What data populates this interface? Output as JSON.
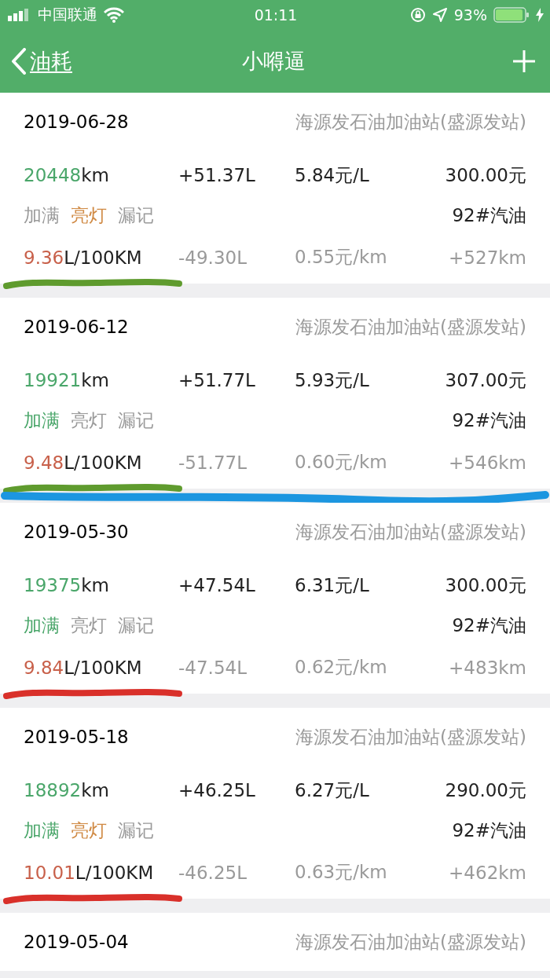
{
  "status_bar": {
    "carrier": "中国联通",
    "time": "01:11",
    "battery": "93%"
  },
  "nav_bar": {
    "back_label": "油耗",
    "title": "小嘚逼"
  },
  "records": [
    {
      "date": "2019-06-28",
      "station": "海源发石油加油站(盛源发站)",
      "odometer": "20448",
      "odometer_unit": "km",
      "volume": "+51.37L",
      "price": "5.84元/L",
      "amount": "300.00元",
      "tags": [
        {
          "kind": "full",
          "label": "加满",
          "on": false
        },
        {
          "kind": "light",
          "label": "亮灯",
          "on": true
        },
        {
          "kind": "missed",
          "label": "漏记",
          "on": false
        }
      ],
      "fuel": "92#汽油",
      "consumption": "9.36",
      "consumption_unit": "L/100KM",
      "used": "-49.30L",
      "cost_per_km": "0.55元/km",
      "distance": "+527km",
      "marks": [
        {
          "kind": "underline",
          "color": "#5f9b2e"
        }
      ]
    },
    {
      "date": "2019-06-12",
      "station": "海源发石油加油站(盛源发站)",
      "odometer": "19921",
      "odometer_unit": "km",
      "volume": "+51.77L",
      "price": "5.93元/L",
      "amount": "307.00元",
      "tags": [
        {
          "kind": "full",
          "label": "加满",
          "on": true
        },
        {
          "kind": "light",
          "label": "亮灯",
          "on": false
        },
        {
          "kind": "missed",
          "label": "漏记",
          "on": false
        }
      ],
      "fuel": "92#汽油",
      "consumption": "9.48",
      "consumption_unit": "L/100KM",
      "used": "-51.77L",
      "cost_per_km": "0.60元/km",
      "distance": "+546km",
      "marks": [
        {
          "kind": "underline",
          "color": "#5f9b2e"
        },
        {
          "kind": "streak",
          "color": "#1c96e0"
        }
      ]
    },
    {
      "date": "2019-05-30",
      "station": "海源发石油加油站(盛源发站)",
      "odometer": "19375",
      "odometer_unit": "km",
      "volume": "+47.54L",
      "price": "6.31元/L",
      "amount": "300.00元",
      "tags": [
        {
          "kind": "full",
          "label": "加满",
          "on": true
        },
        {
          "kind": "light",
          "label": "亮灯",
          "on": false
        },
        {
          "kind": "missed",
          "label": "漏记",
          "on": false
        }
      ],
      "fuel": "92#汽油",
      "consumption": "9.84",
      "consumption_unit": "L/100KM",
      "used": "-47.54L",
      "cost_per_km": "0.62元/km",
      "distance": "+483km",
      "marks": [
        {
          "kind": "underline",
          "color": "#d9302a"
        }
      ]
    },
    {
      "date": "2019-05-18",
      "station": "海源发石油加油站(盛源发站)",
      "odometer": "18892",
      "odometer_unit": "km",
      "volume": "+46.25L",
      "price": "6.27元/L",
      "amount": "290.00元",
      "tags": [
        {
          "kind": "full",
          "label": "加满",
          "on": true
        },
        {
          "kind": "light",
          "label": "亮灯",
          "on": true
        },
        {
          "kind": "missed",
          "label": "漏记",
          "on": false
        }
      ],
      "fuel": "92#汽油",
      "consumption": "10.01",
      "consumption_unit": "L/100KM",
      "used": "-46.25L",
      "cost_per_km": "0.63元/km",
      "distance": "+462km",
      "marks": [
        {
          "kind": "underline",
          "color": "#d9302a"
        }
      ]
    },
    {
      "date": "2019-05-04",
      "station": "海源发石油加油站(盛源发站)"
    }
  ]
}
